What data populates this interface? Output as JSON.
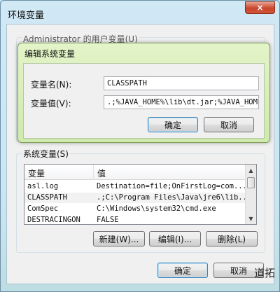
{
  "window": {
    "title": "环境变量",
    "close_label": "×"
  },
  "user_vars": {
    "group_label": "Administrator 的用户变量(U)"
  },
  "edit_dialog": {
    "title": "编辑系统变量",
    "name_label": "变量名(N):",
    "value_label": "变量值(V):",
    "name_value": "CLASSPATH",
    "value_value": ".;%JAVA_HOME%\\lib\\dt.jar;%JAVA_HOME%",
    "ok_label": "确定",
    "cancel_label": "取消"
  },
  "system_vars": {
    "group_label": "系统变量(S)",
    "columns": [
      "变量",
      "值"
    ],
    "rows": [
      {
        "name": "asl.log",
        "value": "Destination=file;OnFirstLog=com..."
      },
      {
        "name": "CLASSPATH",
        "value": ".;C:\\Program Files\\Java\\jre6\\lib..."
      },
      {
        "name": "ComSpec",
        "value": "C:\\Windows\\system32\\cmd.exe"
      },
      {
        "name": "DESTRACINGON",
        "value": "FALSE"
      }
    ],
    "new_label": "新建(W)...",
    "edit_label": "编辑(I)...",
    "delete_label": "删除(L)"
  },
  "footer": {
    "ok_label": "确定",
    "cancel_label": "取消"
  },
  "watermark": "道拓"
}
